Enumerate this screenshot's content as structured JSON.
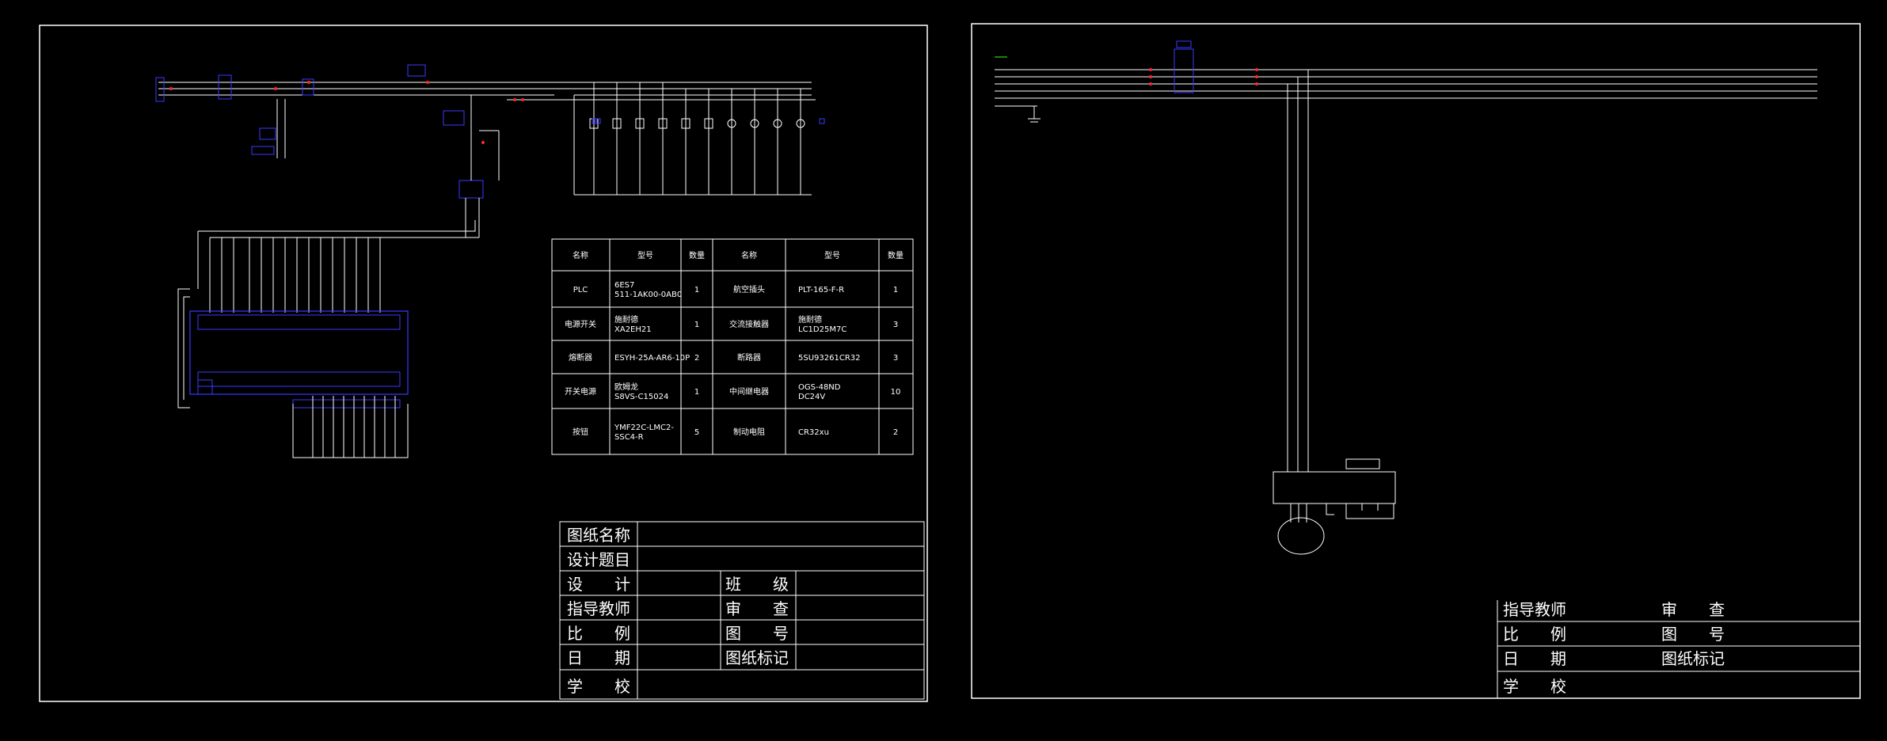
{
  "left_sheet": {
    "bom": {
      "headers": [
        "名称",
        "型号",
        "数量",
        "名称",
        "型号",
        "数量"
      ],
      "rows": [
        {
          "name1": "PLC",
          "model1": "6ES7\n511-1AK00-0AB0",
          "qty1": "1",
          "name2": "航空插头",
          "model2": "PLT-165-F-R",
          "qty2": "1"
        },
        {
          "name1": "电源开关",
          "model1": "施耐德\nXA2EH21",
          "qty1": "1",
          "name2": "交流接触器",
          "model2": "施耐德\nLC1D25M7C",
          "qty2": "3"
        },
        {
          "name1": "熔断器",
          "model1": "ESYH-25A-AR6-10P",
          "qty1": "2",
          "name2": "断路器",
          "model2": "5SU93261CR32",
          "qty2": "3"
        },
        {
          "name1": "开关电源",
          "model1": "欧姆龙\nS8VS-C15024",
          "qty1": "1",
          "name2": "中间继电器",
          "model2": "OGS-48ND\nDC24V",
          "qty2": "10"
        },
        {
          "name1": "按钮",
          "model1": "YMF22C-LMC2-\nSSC4-R",
          "qty1": "5",
          "name2": "制动电阻",
          "model2": "CR32xu",
          "qty2": "2"
        }
      ]
    },
    "title_block": {
      "drawing_name": "图纸名称",
      "design_topic": "设计题目",
      "designer": "设　　计",
      "class": "班　　级",
      "instructor": "指导教师",
      "reviewer": "审　　查",
      "scale": "比　　例",
      "drawing_no": "图　　号",
      "date": "日　　期",
      "drawing_mark": "图纸标记",
      "school": "学　　校"
    }
  },
  "right_sheet": {
    "title_block": {
      "instructor": "指导教师",
      "reviewer": "审　　查",
      "scale": "比　　例",
      "drawing_no": "图　　号",
      "date": "日　　期",
      "drawing_mark": "图纸标记",
      "school": "学　　校"
    }
  },
  "colors": {
    "background": "#000000",
    "line": "#ffffff",
    "component": "#3a3aff",
    "marker": "#ff2a2a",
    "label": "#39ff14"
  }
}
